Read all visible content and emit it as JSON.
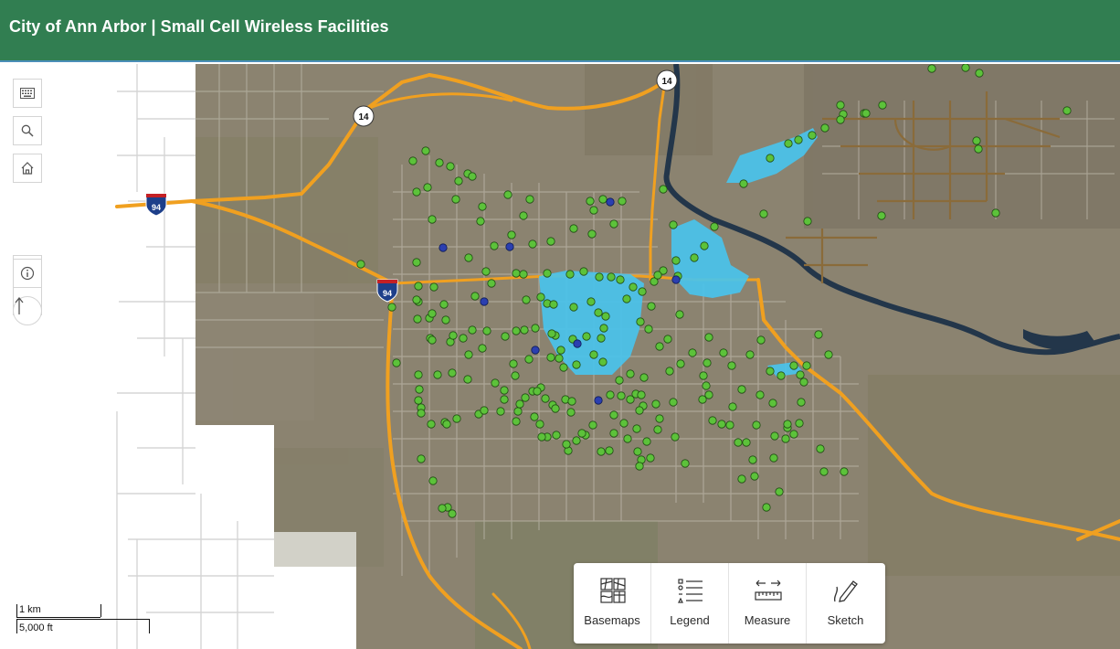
{
  "app": {
    "title": "City of Ann Arbor | Small Cell Wireless Facilities"
  },
  "map": {
    "route_shields": {
      "m14_a": "14",
      "m14_b": "14",
      "i94_a": "94",
      "i94_b": "94"
    },
    "colors": {
      "header": "#317e51",
      "highway": "#f0a020",
      "point_green": "#5cc23a",
      "point_blue": "#2b3fb0",
      "area_blue": "#49c3ec"
    }
  },
  "tools": {
    "keyboard": "keyboard-icon",
    "search": "search-icon",
    "home": "home-icon",
    "zoom_in": "+",
    "zoom_out": "−",
    "info": "info-icon",
    "compass": "compass-icon"
  },
  "scalebar": {
    "metric": "1 km",
    "imperial": "5,000 ft"
  },
  "widgets": [
    {
      "label": "Basemaps",
      "icon": "basemaps-icon"
    },
    {
      "label": "Legend",
      "icon": "legend-icon"
    },
    {
      "label": "Measure",
      "icon": "measure-icon"
    },
    {
      "label": "Sketch",
      "icon": "sketch-icon"
    }
  ]
}
